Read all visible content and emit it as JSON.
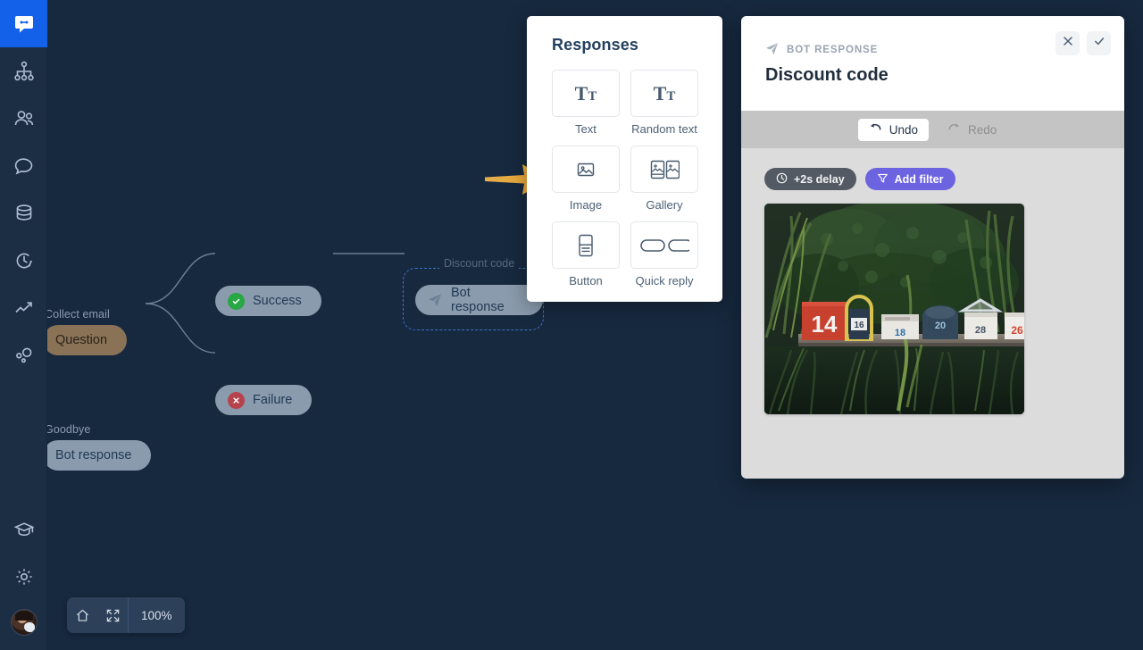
{
  "sidebar": {
    "items": [
      {
        "name": "chat-logo-icon",
        "label": "Chat",
        "active": true
      },
      {
        "name": "sitemap-icon",
        "label": "Bots",
        "active": false
      },
      {
        "name": "users-icon",
        "label": "Users",
        "active": false
      },
      {
        "name": "speech-bubble-icon",
        "label": "Chats",
        "active": false
      },
      {
        "name": "database-icon",
        "label": "Data",
        "active": false
      },
      {
        "name": "clock-history-icon",
        "label": "History",
        "active": false
      },
      {
        "name": "trend-up-icon",
        "label": "Analytics",
        "active": false
      },
      {
        "name": "integrations-icon",
        "label": "Integrations",
        "active": false
      }
    ],
    "bottom": [
      {
        "name": "graduation-cap-icon",
        "label": "Academy"
      },
      {
        "name": "gear-icon",
        "label": "Settings"
      }
    ],
    "avatar_label": "User avatar"
  },
  "canvas": {
    "zoom_toolbar": {
      "home_icon": "home-icon",
      "fit_icon": "fit-screen-icon",
      "zoom_level": "100%"
    },
    "nodes": [
      {
        "id": "collect-email",
        "group_label": "Collect email",
        "pill_label": "Question",
        "style": "brown",
        "badge": "none"
      },
      {
        "id": "success",
        "group_label": "",
        "pill_label": "Success",
        "style": "gray",
        "badge": "check"
      },
      {
        "id": "failure",
        "group_label": "",
        "pill_label": "Failure",
        "style": "gray",
        "badge": "cross"
      },
      {
        "id": "goodbye",
        "group_label": "Goodbye",
        "pill_label": "Bot response",
        "style": "gray",
        "badge": "none"
      },
      {
        "id": "discount-code",
        "group_label": "Discount code",
        "pill_label": "Bot response",
        "style": "gray",
        "badge": "plane"
      }
    ],
    "selected_node_id": "discount-code",
    "arrow_left_name": "pointer-arrow-to-image-tile",
    "arrow_right_name": "pointer-arrow-to-image-preview",
    "arrow_color": "#e8a93c"
  },
  "responses_panel": {
    "title": "Responses",
    "tiles": [
      {
        "label": "Text",
        "icon": "text-icon"
      },
      {
        "label": "Random text",
        "icon": "random-text-icon"
      },
      {
        "label": "Image",
        "icon": "image-icon"
      },
      {
        "label": "Gallery",
        "icon": "gallery-icon"
      },
      {
        "label": "Button",
        "icon": "button-icon"
      },
      {
        "label": "Quick reply",
        "icon": "quick-reply-icon"
      }
    ]
  },
  "edit_panel": {
    "kicker": "BOT RESPONSE",
    "kicker_icon": "paper-plane-icon",
    "title": "Discount code",
    "close_icon": "close-icon",
    "accept_icon": "check-icon",
    "toolbar": {
      "undo_label": "Undo",
      "undo_icon": "undo-arrow-icon",
      "undo_enabled": true,
      "redo_label": "Redo",
      "redo_icon": "redo-arrow-icon",
      "redo_enabled": false
    },
    "chips": [
      {
        "label": "+2s delay",
        "icon": "clock-icon",
        "style": "delay",
        "color": "#545a63"
      },
      {
        "label": "Add filter",
        "icon": "funnel-icon",
        "style": "filter",
        "color": "#6c63e0"
      }
    ],
    "image": {
      "name": "mailboxes-photo",
      "alt": "Row of numbered mailboxes on a wooden rail in front of greenery",
      "mailbox_numbers": [
        "14",
        "16",
        "18",
        "20",
        "28",
        "26"
      ]
    }
  },
  "colors": {
    "canvas_bg": "#17293f",
    "sidebar_bg": "#1c2e44",
    "sidebar_active": "#1361e8",
    "node_gray": "#8a9bad",
    "node_brown": "#8a7257",
    "selection_dash": "#3d72c7",
    "panel_body": "#dcdcdc",
    "toolbar_bg": "#c4c4c4",
    "accent_purple": "#6c63e0",
    "arrow_amber": "#e8a93c"
  }
}
